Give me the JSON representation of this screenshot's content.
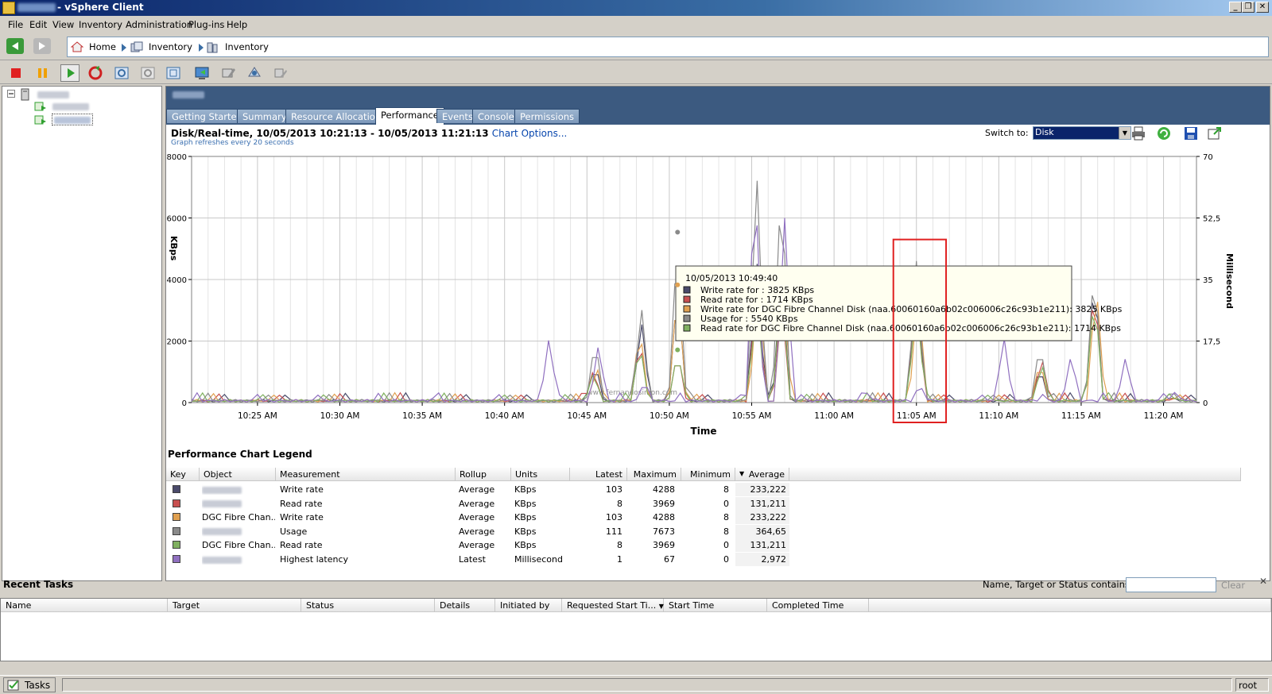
{
  "window": {
    "title": "- vSphere Client"
  },
  "menu": [
    "File",
    "Edit",
    "View",
    "Inventory",
    "Administration",
    "Plug-ins",
    "Help"
  ],
  "breadcrumb": [
    "Home",
    "Inventory",
    "Inventory"
  ],
  "tabs": [
    "Getting Started",
    "Summary",
    "Resource Allocation",
    "Performance",
    "Events",
    "Console",
    "Permissions"
  ],
  "active_tab": "Performance",
  "perf": {
    "title": "Disk/Real-time, 10/05/2013 10:21:13 - 10/05/2013 11:21:13",
    "chart_options": "Chart Options...",
    "refresh_note": "Graph refreshes every 20 seconds",
    "switch_label": "Switch to:",
    "switch_value": "Disk"
  },
  "chart_data": {
    "type": "line",
    "xlabel": "Time",
    "ylabel": "KBps",
    "y2label": "Millisecond",
    "ylim": [
      0,
      8000
    ],
    "y2lim": [
      0,
      70
    ],
    "yticks": [
      "0",
      "2000",
      "4000",
      "6000",
      "8000"
    ],
    "y2ticks": [
      "0",
      "17,5",
      "35",
      "52,5",
      "70"
    ],
    "x_ticks": [
      "10:25 AM",
      "10:30 AM",
      "10:35 AM",
      "10:40 AM",
      "10:45 AM",
      "10:50 AM",
      "10:55 AM",
      "11:00 AM",
      "11:05 AM",
      "11:10 AM",
      "11:15 AM",
      "11:20 AM"
    ],
    "x_minutes": [
      24,
      29,
      34,
      39,
      44,
      49,
      54,
      59,
      64,
      69,
      74,
      79
    ],
    "xlim": [
      20,
      81
    ],
    "grid": true,
    "watermark": "www.fernandosimon.com",
    "series": [
      {
        "name": "Write rate",
        "color": "#4a4a6a",
        "peaks": [
          [
            44.5,
            1300
          ],
          [
            47.3,
            2700
          ],
          [
            49.5,
            3825
          ],
          [
            54.3,
            4800
          ],
          [
            55.8,
            4288
          ],
          [
            64,
            4000
          ],
          [
            71.5,
            1200
          ],
          [
            74.8,
            4288
          ],
          [
            79.5,
            200
          ]
        ]
      },
      {
        "name": "Read rate",
        "color": "#c85050",
        "peaks": [
          [
            44.4,
            1100
          ],
          [
            47.2,
            2100
          ],
          [
            49.5,
            1714
          ],
          [
            54.3,
            3969
          ],
          [
            55.8,
            3500
          ],
          [
            64,
            3600
          ],
          [
            71.6,
            1500
          ],
          [
            74.8,
            3969
          ],
          [
            79.6,
            150
          ]
        ]
      },
      {
        "name": "Write rate for DGC Fibre Channel Disk",
        "color": "#e0a050",
        "peaks": [
          [
            44.6,
            1200
          ],
          [
            47.2,
            2500
          ],
          [
            49.5,
            3825
          ],
          [
            54.4,
            4288
          ],
          [
            55.9,
            3800
          ],
          [
            64.1,
            3700
          ],
          [
            71.5,
            1400
          ],
          [
            74.9,
            4000
          ],
          [
            79.5,
            180
          ]
        ]
      },
      {
        "name": "Usage",
        "color": "#8a8a8a",
        "peaks": [
          [
            44.5,
            2100
          ],
          [
            47.3,
            3200
          ],
          [
            49.5,
            5540
          ],
          [
            54.3,
            7673
          ],
          [
            55.8,
            7600
          ],
          [
            64,
            4600
          ],
          [
            71.5,
            2000
          ],
          [
            74.8,
            4600
          ],
          [
            79.5,
            400
          ]
        ]
      },
      {
        "name": "Read rate for DGC Fibre Channel Disk",
        "color": "#80b060",
        "peaks": [
          [
            44.4,
            1000
          ],
          [
            47.2,
            2000
          ],
          [
            49.5,
            1714
          ],
          [
            54.3,
            3500
          ],
          [
            55.8,
            3969
          ],
          [
            64,
            3400
          ],
          [
            71.6,
            1300
          ],
          [
            74.8,
            3700
          ],
          [
            79.6,
            150
          ]
        ]
      },
      {
        "name": "Highest latency",
        "color": "#9070c0",
        "peaks": [
          [
            34.8,
            200
          ],
          [
            41.7,
            2150
          ],
          [
            44.7,
            1900
          ],
          [
            47.5,
            700
          ],
          [
            54.2,
            7600
          ],
          [
            56,
            6000
          ],
          [
            61,
            300
          ],
          [
            64.2,
            600
          ],
          [
            69.3,
            2200
          ],
          [
            73.4,
            1600
          ],
          [
            76.7,
            1500
          ],
          [
            79.7,
            350
          ]
        ]
      }
    ],
    "tooltip": {
      "time": "10/05/2013 10:49:40",
      "lines": [
        {
          "text": "Write rate for : 3825 KBps",
          "color": "#4a4a6a"
        },
        {
          "text": "Read rate for : 1714 KBps",
          "color": "#c85050"
        },
        {
          "text": "Write rate for DGC Fibre Channel Disk (naa.60060160a6b02c006006c26c93b1e211): 3825 KBps",
          "color": "#e0a050"
        },
        {
          "text": "Usage for : 5540 KBps",
          "color": "#8a8a8a"
        },
        {
          "text": "Read rate for DGC Fibre Channel Disk (naa.60060160a6b02c006006c26c93b1e211): 1714 KBps",
          "color": "#80b060"
        }
      ]
    },
    "highlight_box": {
      "from_minute": 62.6,
      "to_minute": 65.8,
      "color": "#e02020"
    }
  },
  "legend": {
    "title": "Performance Chart Legend",
    "headers": [
      "Key",
      "Object",
      "Measurement",
      "Rollup",
      "Units",
      "Latest",
      "Maximum",
      "Minimum",
      "Average"
    ],
    "rows": [
      {
        "color": "#4a4a6a",
        "object": "",
        "measurement": "Write rate",
        "rollup": "Average",
        "units": "KBps",
        "latest": "103",
        "maximum": "4288",
        "minimum": "8",
        "average": "233,222"
      },
      {
        "color": "#c85050",
        "object": "",
        "measurement": "Read rate",
        "rollup": "Average",
        "units": "KBps",
        "latest": "8",
        "maximum": "3969",
        "minimum": "0",
        "average": "131,211"
      },
      {
        "color": "#e0a050",
        "object": "DGC Fibre Chan...",
        "measurement": "Write rate",
        "rollup": "Average",
        "units": "KBps",
        "latest": "103",
        "maximum": "4288",
        "minimum": "8",
        "average": "233,222"
      },
      {
        "color": "#8a8a8a",
        "object": "",
        "measurement": "Usage",
        "rollup": "Average",
        "units": "KBps",
        "latest": "111",
        "maximum": "7673",
        "minimum": "8",
        "average": "364,65"
      },
      {
        "color": "#80b060",
        "object": "DGC Fibre Chan...",
        "measurement": "Read rate",
        "rollup": "Average",
        "units": "KBps",
        "latest": "8",
        "maximum": "3969",
        "minimum": "0",
        "average": "131,211"
      },
      {
        "color": "#9070c0",
        "object": "",
        "measurement": "Highest latency",
        "rollup": "Latest",
        "units": "Millisecond",
        "latest": "1",
        "maximum": "67",
        "minimum": "0",
        "average": "2,972"
      }
    ]
  },
  "recent_tasks": {
    "title": "Recent Tasks",
    "filter_label": "Name, Target or Status contains: ▾",
    "filter_value": "",
    "clear_label": "Clear",
    "headers": [
      "Name",
      "Target",
      "Status",
      "Details",
      "Initiated by",
      "Requested Start Ti...",
      "Start Time",
      "Completed Time"
    ]
  },
  "status": {
    "tasks_label": "Tasks",
    "user": "root"
  }
}
